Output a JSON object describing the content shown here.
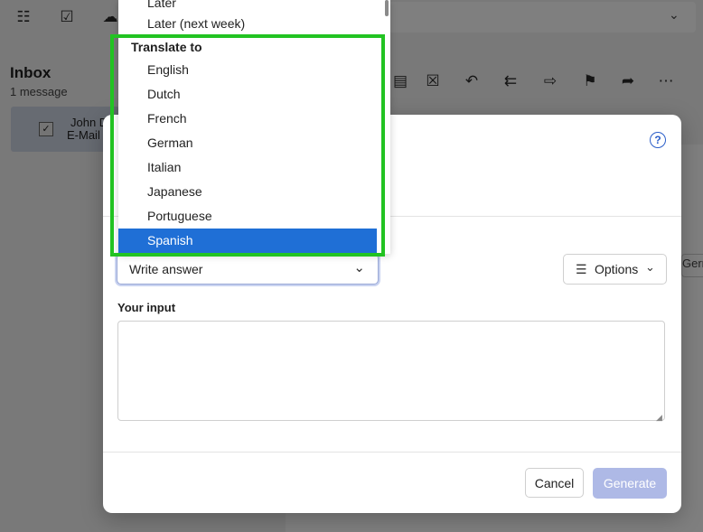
{
  "inbox": {
    "title": "Inbox",
    "count": "1 message"
  },
  "message": {
    "sender": "John D",
    "subject": "E-Mail"
  },
  "right_pane": {
    "tab_partial": "Gern"
  },
  "dialog": {
    "action_value": "Write answer",
    "options_label": "Options",
    "input_label": "Your input",
    "input_value": "",
    "cancel_label": "Cancel",
    "generate_label": "Generate",
    "help_symbol": "?"
  },
  "menu": {
    "above_items": [
      "Later",
      "Later (next week)"
    ],
    "section_header": "Translate to",
    "languages": [
      "English",
      "Dutch",
      "French",
      "German",
      "Italian",
      "Japanese",
      "Portuguese",
      "Spanish"
    ],
    "selected": "Spanish"
  },
  "colors": {
    "accent": "#1f6fd6",
    "highlight": "#22c322",
    "generate_disabled": "#aeb9e6"
  }
}
